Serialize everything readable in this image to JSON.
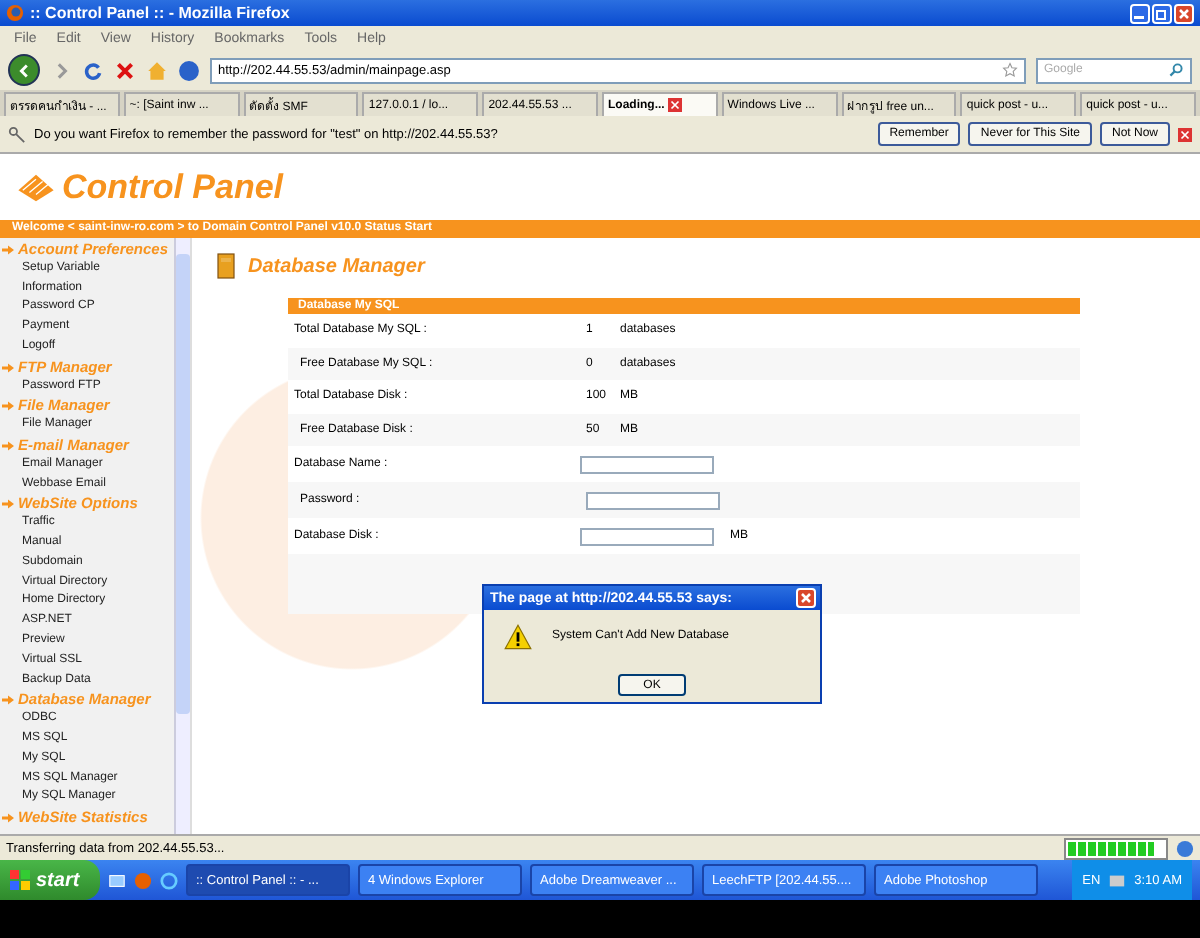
{
  "window": {
    "title": ":: Control Panel :: - Mozilla Firefox"
  },
  "menu": [
    "File",
    "Edit",
    "View",
    "History",
    "Bookmarks",
    "Tools",
    "Help"
  ],
  "address": {
    "value": "http://202.44.55.53/admin/mainpage.asp"
  },
  "search": {
    "placeholder": "Google"
  },
  "tabs": [
    {
      "label": "ตรรดคนกำเงิน - ...",
      "selected": false
    },
    {
      "label": "~: [Saint inw ...",
      "selected": false
    },
    {
      "label": "ตัดตั้ง SMF",
      "selected": false
    },
    {
      "label": "127.0.0.1 / lo...",
      "selected": false
    },
    {
      "label": "202.44.55.53 ...",
      "selected": false
    },
    {
      "label": "Loading...",
      "selected": true
    },
    {
      "label": "Windows Live ...",
      "selected": false
    },
    {
      "label": "ฝากรูป free un...",
      "selected": false
    },
    {
      "label": "quick post - u...",
      "selected": false
    },
    {
      "label": "quick post - u...",
      "selected": false
    }
  ],
  "password_bar": {
    "message": "Do you want Firefox to remember the password for \"test\" on http://202.44.55.53?",
    "buttons": [
      "Remember",
      "Never for This Site",
      "Not Now"
    ]
  },
  "page": {
    "logo": "Control Panel",
    "welcome": "Welcome < saint-inw-ro.com > to Domain Control Panel v10.0 Status Start",
    "sidebar": [
      {
        "heading": "Account Preferences",
        "children": [
          "Setup Variable",
          "Information",
          "Password CP",
          "Payment",
          "Logoff"
        ]
      },
      {
        "heading": "FTP Manager",
        "children": [
          "Password FTP"
        ]
      },
      {
        "heading": "File Manager",
        "children": [
          "File Manager"
        ]
      },
      {
        "heading": "E-mail Manager",
        "children": [
          "Email Manager",
          "Webbase Email"
        ]
      },
      {
        "heading": "WebSite Options",
        "children": [
          "Traffic",
          "Manual",
          "Subdomain",
          "Virtual Directory",
          "Home Directory",
          "ASP.NET",
          "Preview",
          "Virtual SSL",
          "Backup Data"
        ]
      },
      {
        "heading": "Database Manager",
        "children": [
          "ODBC",
          "MS SQL",
          "My SQL",
          "MS SQL Manager",
          "My SQL Manager"
        ]
      },
      {
        "heading": "WebSite Statistics"
      }
    ],
    "title": "Database Manager",
    "section": "Database My SQL",
    "stats": [
      {
        "label": "Total Database My SQL :",
        "value": "1",
        "unit": "databases"
      },
      {
        "label": "Free Database My SQL :",
        "value": "0",
        "unit": "databases"
      },
      {
        "label": "Total Database Disk :",
        "value": "100",
        "unit": "MB"
      },
      {
        "label": "Free Database Disk :",
        "value": "50",
        "unit": "MB"
      }
    ],
    "fields": [
      {
        "label": "Database Name :"
      },
      {
        "label": "Password :"
      },
      {
        "label": "Database Disk :",
        "unit": "MB"
      }
    ]
  },
  "dialog": {
    "title": "The page at http://202.44.55.53 says:",
    "message": "System Can't Add New Database",
    "button": "OK"
  },
  "status_bar": {
    "text": "Transferring data from 202.44.55.53...",
    "level": 0.9
  },
  "taskbar": {
    "start": "start",
    "tasks": [
      {
        "label": ":: Control Panel :: - ...",
        "selected": true
      },
      {
        "label": "4 Windows Explorer",
        "selected": false
      },
      {
        "label": "Adobe Dreamweaver ...",
        "selected": false
      },
      {
        "label": "LeechFTP [202.44.55....",
        "selected": false
      },
      {
        "label": "Adobe Photoshop",
        "selected": false
      }
    ],
    "language": "EN",
    "clock": "3:10 AM"
  }
}
